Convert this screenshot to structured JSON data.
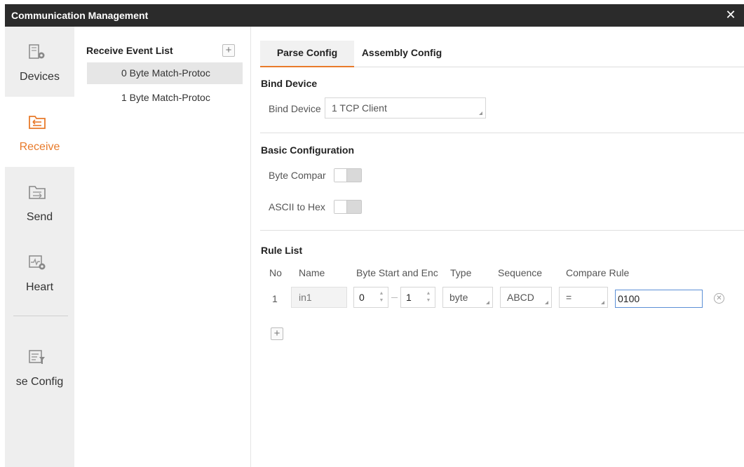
{
  "window": {
    "title": "Communication Management",
    "close_symbol": "✕"
  },
  "sidebar": {
    "items": [
      {
        "label": "Devices",
        "icon": "devices-icon",
        "active": false
      },
      {
        "label": "Receive",
        "icon": "receive-folder-icon",
        "active": true
      },
      {
        "label": "Send",
        "icon": "send-folder-icon",
        "active": false
      },
      {
        "label": "Heart",
        "icon": "heartbeat-icon",
        "active": false
      },
      {
        "label": "se Config",
        "icon": "config-icon",
        "active": false
      }
    ],
    "active_color": "#e87a2a"
  },
  "event_list": {
    "header": "Receive Event List",
    "add_symbol": "+",
    "items": [
      {
        "label": "0 Byte Match-Protoc",
        "selected": true
      },
      {
        "label": "1 Byte Match-Protoc",
        "selected": false
      }
    ]
  },
  "tabs": [
    {
      "label": "Parse Config",
      "active": true
    },
    {
      "label": "Assembly Config",
      "active": false
    }
  ],
  "bind_device": {
    "section_title": "Bind Device",
    "field_label": "Bind Device",
    "value": "1 TCP Client"
  },
  "basic_config": {
    "section_title": "Basic Configuration",
    "byte_compare_label": "Byte Compar",
    "byte_compare_on": false,
    "ascii_to_hex_label": "ASCII to Hex",
    "ascii_to_hex_on": false
  },
  "rule_list": {
    "section_title": "Rule List",
    "columns": [
      "No",
      "Name",
      "Byte Start and Enc",
      "Type",
      "Sequence",
      "Compare Rule"
    ],
    "rows": [
      {
        "no": "1",
        "name": "in1",
        "byte_start": "0",
        "byte_end": "1",
        "type": "byte",
        "sequence": "ABCD",
        "compare_op": "=",
        "compare_value": "0100"
      }
    ],
    "add_symbol": "+",
    "remove_symbol": "✕"
  }
}
